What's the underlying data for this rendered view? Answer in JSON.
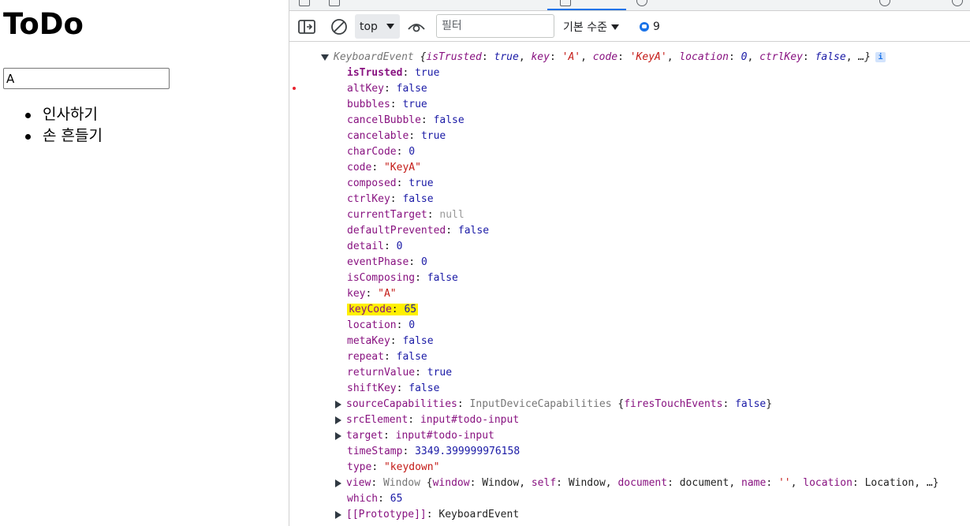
{
  "page": {
    "title": "ToDo",
    "input_value": "A",
    "todos": [
      "인사하기",
      "손 흔들기"
    ]
  },
  "devtools": {
    "toolbar": {
      "context": "top",
      "filter_placeholder": "필터",
      "level": "기본 수준",
      "issues_count": "9"
    },
    "console": {
      "summary_type": "KeyboardEvent",
      "summary_parts": [
        {
          "k": "isTrusted",
          "v": "true",
          "t": "bool"
        },
        {
          "k": "key",
          "v": "'A'",
          "t": "str"
        },
        {
          "k": "code",
          "v": "'KeyA'",
          "t": "str"
        },
        {
          "k": "location",
          "v": "0",
          "t": "num"
        },
        {
          "k": "ctrlKey",
          "v": "false",
          "t": "bool"
        }
      ],
      "summary_more": "…}",
      "info_badge": "i",
      "properties": [
        {
          "key": "isTrusted",
          "value": "true",
          "type": "bool",
          "strong": true
        },
        {
          "key": "altKey",
          "value": "false",
          "type": "bool"
        },
        {
          "key": "bubbles",
          "value": "true",
          "type": "bool"
        },
        {
          "key": "cancelBubble",
          "value": "false",
          "type": "bool"
        },
        {
          "key": "cancelable",
          "value": "true",
          "type": "bool"
        },
        {
          "key": "charCode",
          "value": "0",
          "type": "num"
        },
        {
          "key": "code",
          "value": "\"KeyA\"",
          "type": "str"
        },
        {
          "key": "composed",
          "value": "true",
          "type": "bool"
        },
        {
          "key": "ctrlKey",
          "value": "false",
          "type": "bool"
        },
        {
          "key": "currentTarget",
          "value": "null",
          "type": "null"
        },
        {
          "key": "defaultPrevented",
          "value": "false",
          "type": "bool"
        },
        {
          "key": "detail",
          "value": "0",
          "type": "num"
        },
        {
          "key": "eventPhase",
          "value": "0",
          "type": "num"
        },
        {
          "key": "isComposing",
          "value": "false",
          "type": "bool"
        },
        {
          "key": "key",
          "value": "\"A\"",
          "type": "str"
        },
        {
          "key": "keyCode",
          "value": "65",
          "type": "num",
          "highlight": true
        },
        {
          "key": "location",
          "value": "0",
          "type": "num"
        },
        {
          "key": "metaKey",
          "value": "false",
          "type": "bool"
        },
        {
          "key": "repeat",
          "value": "false",
          "type": "bool"
        },
        {
          "key": "returnValue",
          "value": "true",
          "type": "bool"
        },
        {
          "key": "shiftKey",
          "value": "false",
          "type": "bool"
        },
        {
          "key": "sourceCapabilities",
          "value": "InputDeviceCapabilities {firesTouchEvents: false}",
          "type": "expand-cap"
        },
        {
          "key": "srcElement",
          "value": "input#todo-input",
          "type": "expand-node"
        },
        {
          "key": "target",
          "value": "input#todo-input",
          "type": "expand-node"
        },
        {
          "key": "timeStamp",
          "value": "3349.399999976158",
          "type": "num"
        },
        {
          "key": "type",
          "value": "\"keydown\"",
          "type": "str"
        },
        {
          "key": "view",
          "value": "Window {window: Window, self: Window, document: document, name: '', location: Location, …}",
          "type": "expand-win"
        },
        {
          "key": "which",
          "value": "65",
          "type": "num"
        },
        {
          "key": "[[Prototype]]",
          "value": "KeyboardEvent",
          "type": "expand-proto"
        }
      ]
    }
  }
}
